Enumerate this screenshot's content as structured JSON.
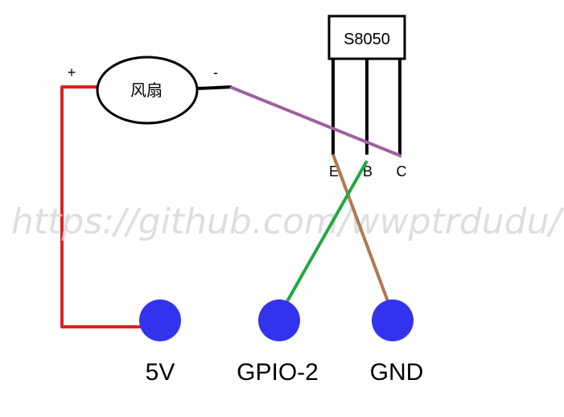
{
  "components": {
    "fan": {
      "label": "风扇",
      "plus_label": "+",
      "minus_label": "-"
    },
    "transistor": {
      "label": "S8050",
      "pin_e": "E",
      "pin_b": "B",
      "pin_c": "C"
    }
  },
  "terminals": {
    "vcc": {
      "label": "5V"
    },
    "gpio": {
      "label": "GPIO-2"
    },
    "gnd": {
      "label": "GND"
    }
  },
  "watermark": {
    "text": "https://github.com/wwptrdudu/"
  },
  "colors": {
    "power_wire": "#e02020",
    "fan_to_collector_wire": "#a060a0",
    "gpio_to_base_wire": "#20a840",
    "emitter_to_gnd_wire": "#b07850",
    "terminal_fill": "#3333ee",
    "outline": "#000000"
  }
}
